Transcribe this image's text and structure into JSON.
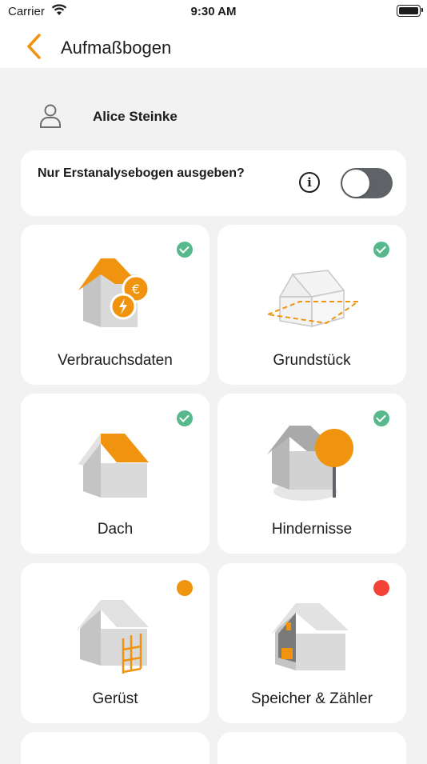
{
  "status_bar": {
    "carrier": "Carrier",
    "time": "9:30 AM"
  },
  "nav": {
    "title": "Aufmaßbogen"
  },
  "user": {
    "name": "Alice Steinke"
  },
  "toggle": {
    "label": "Nur Erstanalysebogen ausgeben?",
    "enabled": false
  },
  "colors": {
    "accent": "#f0930e",
    "done": "#57b98b",
    "error": "#f44336",
    "toggle_off": "#5f6368"
  },
  "cards": [
    {
      "label": "Verbrauchsdaten",
      "icon": "house-euro-energy-icon",
      "status": "done"
    },
    {
      "label": "Grundstück",
      "icon": "plot-outline-icon",
      "status": "done"
    },
    {
      "label": "Dach",
      "icon": "house-roof-icon",
      "status": "done"
    },
    {
      "label": "Hindernisse",
      "icon": "house-tree-obstacle-icon",
      "status": "done"
    },
    {
      "label": "Gerüst",
      "icon": "house-scaffold-icon",
      "status": "pending"
    },
    {
      "label": "Speicher & Zähler",
      "icon": "house-storage-meter-icon",
      "status": "error"
    }
  ]
}
